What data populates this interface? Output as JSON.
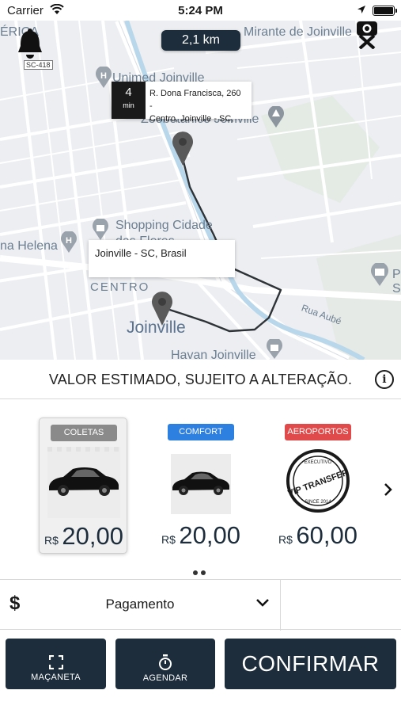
{
  "status_bar": {
    "carrier": "Carrier",
    "time": "5:24 PM"
  },
  "map": {
    "distance": "2,1 km",
    "road_shield": "SC-418",
    "labels": {
      "top_left": "ÉRICA",
      "mirante": "Mirante de Joinville",
      "unimed": "Unimed Joinville",
      "zoo": "Zoobotânico Joinville",
      "shopping": "Shopping Cidade",
      "shopping_2": "das Flores",
      "ana_helena": "na Helena",
      "centro": "CENTRO",
      "joinville": "Joinville",
      "havan": "Havan Joinville",
      "rua_aube": "Rua Aubé",
      "right_edge_1": "P",
      "right_edge_2": "S"
    },
    "origin": {
      "eta_value": "4",
      "eta_unit": "min",
      "address_line1": "R. Dona Francisca, 260 -",
      "address_line2": "Centro, Joinville - SC,"
    },
    "destination": {
      "address": "Joinville - SC, Brasil"
    }
  },
  "estimate_notice": "VALOR ESTIMADO, SUJEITO A ALTERAÇÃO.",
  "info_symbol": "i",
  "vehicle_options": [
    {
      "tag": "COLETAS",
      "tag_color": "#8a8a8a",
      "currency": "R$",
      "price": "20,00",
      "selected": true
    },
    {
      "tag": "COMFORT",
      "tag_color": "#2d7fe0",
      "currency": "R$",
      "price": "20,00",
      "selected": false
    },
    {
      "tag": "AEROPORTOS",
      "tag_color": "#e04a4a",
      "currency": "R$",
      "price": "60,00",
      "selected": false
    }
  ],
  "vip_stamp": {
    "top": "EXECUTIVO",
    "main": "VIP TRANSFER",
    "bottom": "SINCE 2014"
  },
  "payment": {
    "currency_symbol": "$",
    "label": "Pagamento"
  },
  "buttons": {
    "macaneta": "MAÇANETA",
    "agendar": "AGENDAR",
    "confirm": "CONFIRMAR"
  },
  "colors": {
    "navy": "#1d2d3c",
    "route": "#2e3338",
    "pin": "#5a5a5a"
  }
}
